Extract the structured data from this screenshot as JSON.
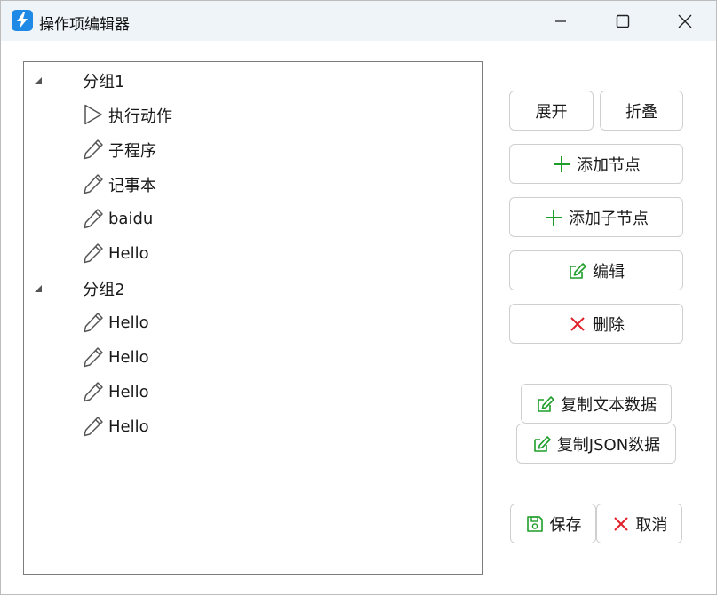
{
  "window": {
    "title": "操作项编辑器"
  },
  "tree": {
    "groups": [
      {
        "label": "分组1",
        "items": [
          {
            "label": "执行动作",
            "icon": "play-icon"
          },
          {
            "label": "子程序",
            "icon": "pencil-icon"
          },
          {
            "label": "记事本",
            "icon": "pencil-icon"
          },
          {
            "label": "baidu",
            "icon": "pencil-icon"
          },
          {
            "label": "Hello",
            "icon": "pencil-icon"
          }
        ]
      },
      {
        "label": "分组2",
        "items": [
          {
            "label": "Hello",
            "icon": "pencil-icon"
          },
          {
            "label": "Hello",
            "icon": "pencil-icon"
          },
          {
            "label": "Hello",
            "icon": "pencil-icon"
          },
          {
            "label": "Hello",
            "icon": "pencil-icon"
          }
        ]
      }
    ]
  },
  "buttons": {
    "expand": "展开",
    "collapse": "折叠",
    "add_node": "添加节点",
    "add_child_node": "添加子节点",
    "edit": "编辑",
    "delete": "删除",
    "copy_text": "复制文本数据",
    "copy_json": "复制JSON数据",
    "save": "保存",
    "cancel": "取消"
  },
  "colors": {
    "accent_green": "#1e9e28",
    "delete_red": "#e0202a",
    "app_icon_blue": "#1f8ae6"
  }
}
